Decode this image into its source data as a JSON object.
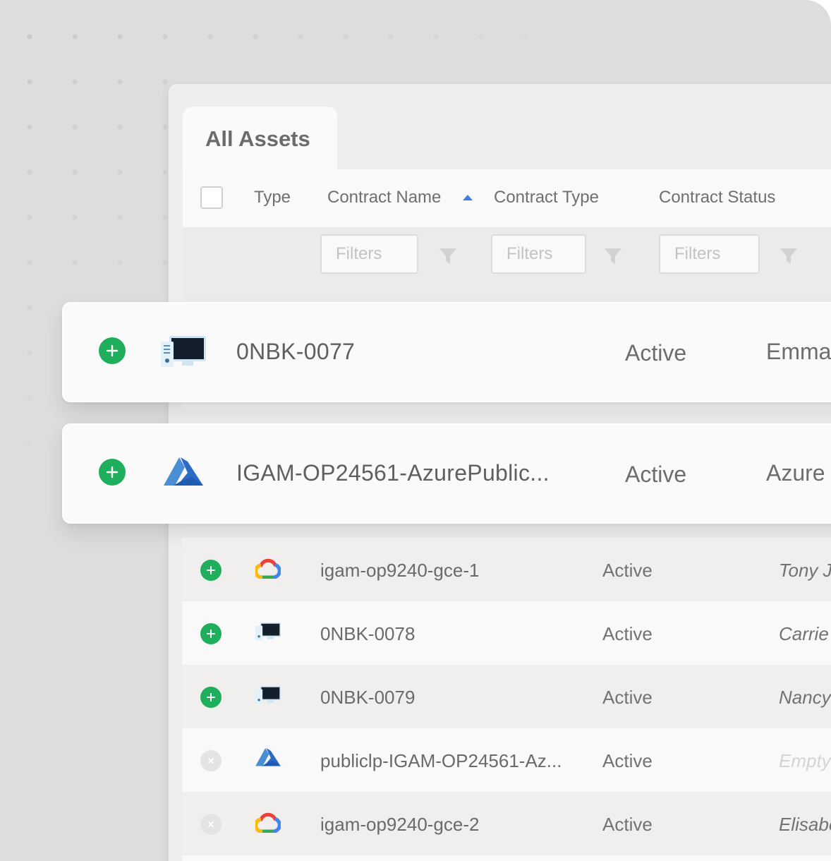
{
  "tab": {
    "label": "All Assets"
  },
  "columns": {
    "type": "Type",
    "contract_name": "Contract Name",
    "contract_type": "Contract Type",
    "contract_status": "Contract Status"
  },
  "filters": {
    "placeholder": "Filters"
  },
  "colors": {
    "add": "#1fae5c",
    "accent": "#3f7de0",
    "disabled": "#e4e4e4"
  },
  "featured_rows": [
    {
      "name": "0NBK-0077",
      "status": "Active",
      "owner": "Emma",
      "icon": "server-monitor-icon"
    },
    {
      "name": "IGAM-OP24561-AzurePublic...",
      "status": "Active",
      "owner": "Azure",
      "icon": "azure-icon"
    }
  ],
  "rows": [
    {
      "name": "igam-op9240-gce-1",
      "status": "Active",
      "owner": "Tony J",
      "icon": "google-cloud-icon",
      "action": "add"
    },
    {
      "name": "0NBK-0078",
      "status": "Active",
      "owner": "Carrie",
      "icon": "server-monitor-icon",
      "action": "add"
    },
    {
      "name": "0NBK-0079",
      "status": "Active",
      "owner": "Nancy",
      "icon": "server-monitor-icon",
      "action": "add"
    },
    {
      "name": "publiclp-IGAM-OP24561-Az...",
      "status": "Active",
      "owner": "Empty",
      "icon": "azure-icon",
      "action": "remove"
    },
    {
      "name": "igam-op9240-gce-2",
      "status": "Active",
      "owner": "Elisabeth",
      "icon": "google-cloud-icon",
      "action": "remove"
    }
  ]
}
